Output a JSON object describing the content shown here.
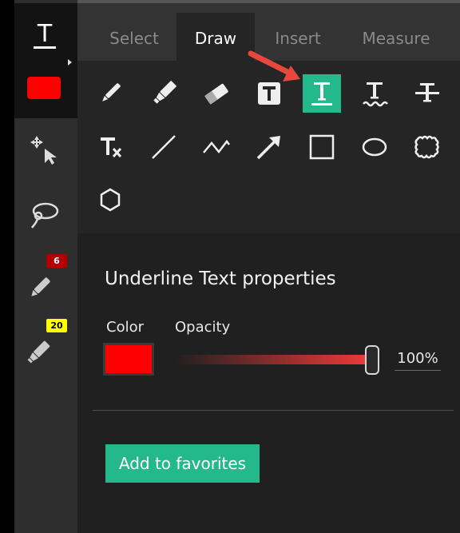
{
  "colors": {
    "accent": "#24b98b",
    "current_color": "#ff0000",
    "arrow": "#e8473c"
  },
  "rail": {
    "tool_glyph": "T",
    "items": [
      {
        "name": "text-tool-icon"
      },
      {
        "name": "pan-select-icon"
      },
      {
        "name": "lasso-icon"
      },
      {
        "name": "pen-icon",
        "badge": "6",
        "badge_color": "#b00000"
      },
      {
        "name": "highlighter-icon",
        "badge": "20",
        "badge_color": "#ffff00"
      }
    ]
  },
  "tabs": [
    {
      "label": "Select"
    },
    {
      "label": "Draw",
      "active": true
    },
    {
      "label": "Insert"
    },
    {
      "label": "Measure"
    }
  ],
  "tools": [
    "pen-icon",
    "highlighter-icon",
    "eraser-icon",
    "free-text-icon",
    "underline-text-icon",
    "squiggly-text-icon",
    "strikeout-text-icon",
    "clear-text-format-icon",
    "line-icon",
    "polyline-icon",
    "arrow-icon",
    "rectangle-icon",
    "ellipse-icon",
    "cloud-icon",
    "polygon-icon"
  ],
  "properties": {
    "title": "Underline Text properties",
    "color_label": "Color",
    "opacity_label": "Opacity",
    "opacity_value": "100%",
    "opacity_level": 1.0,
    "favorites_button": "Add to favorites"
  }
}
